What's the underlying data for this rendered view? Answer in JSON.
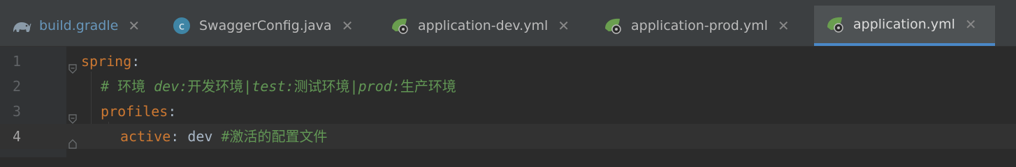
{
  "tabs": [
    {
      "label": "build.gradle",
      "icon": "gradle-icon",
      "active": false
    },
    {
      "label": "SwaggerConfig.java",
      "icon": "java-class-icon",
      "active": false
    },
    {
      "label": "application-dev.yml",
      "icon": "spring-yml-icon",
      "active": false
    },
    {
      "label": "application-prod.yml",
      "icon": "spring-yml-icon",
      "active": false
    },
    {
      "label": "application.yml",
      "icon": "spring-yml-icon",
      "active": true
    }
  ],
  "close_glyph": "✕",
  "editor": {
    "line_numbers": [
      "1",
      "2",
      "3",
      "4"
    ],
    "current_line": "4",
    "line1": {
      "key": "spring",
      "colon": ":"
    },
    "line2": {
      "hash": "# 环境 ",
      "dev_key": "dev:",
      "dev_text": "开发环境|",
      "test_key": "test:",
      "test_text": "测试环境|",
      "prod_key": "prod:",
      "prod_text": "生产环境"
    },
    "line3": {
      "key": "profiles",
      "colon": ":"
    },
    "line4": {
      "key": "active",
      "colon": ":",
      "value": " dev ",
      "comment": "#激活的配置文件"
    }
  },
  "colors": {
    "keyword": "#cc7832",
    "comment": "#629755",
    "text": "#a9b7c6",
    "active_tab_underline": "#4a88c7"
  }
}
